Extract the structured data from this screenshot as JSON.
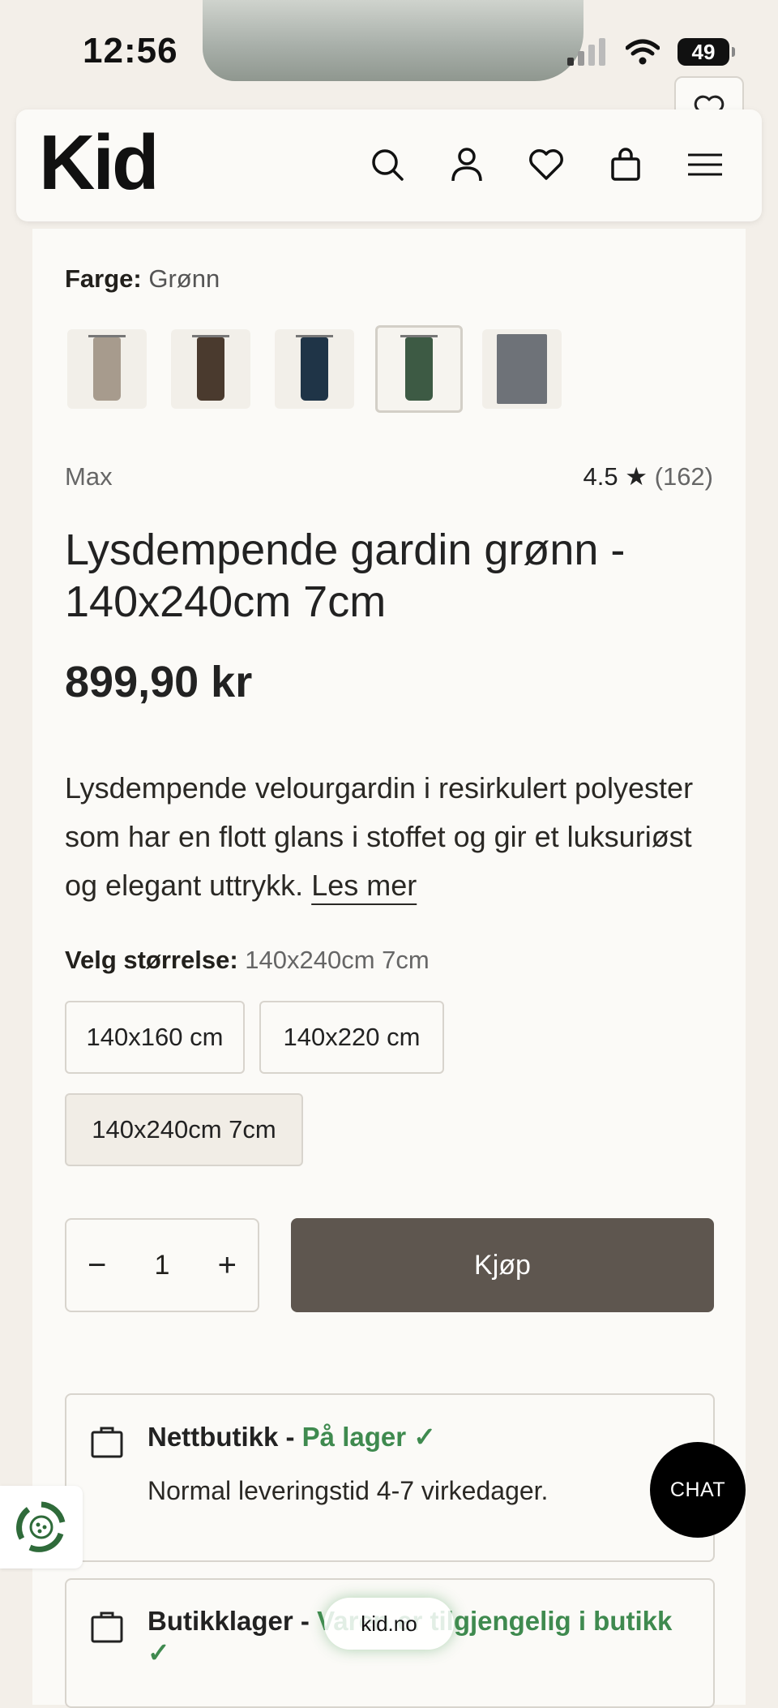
{
  "status_bar": {
    "time": "12:56",
    "battery": "49"
  },
  "header": {
    "logo": "Kid"
  },
  "product": {
    "color_label": "Farge:",
    "color_value": "Grønn",
    "swatches": [
      {
        "name": "beige",
        "color": "#a79b8d"
      },
      {
        "name": "brun",
        "color": "#4a3a2e"
      },
      {
        "name": "blå",
        "color": "#1f3447"
      },
      {
        "name": "grønn",
        "color": "#3d5a44",
        "selected": true
      },
      {
        "name": "grå",
        "color": "#6e7278"
      }
    ],
    "brand": "Max",
    "rating": "4.5 ★",
    "review_count": "(162)",
    "title": "Lysdempende gardin grønn - 140x240cm 7cm",
    "price": "899,90 kr",
    "description": "Lysdempende velourgardin i resirkulert polyester som har en flott glans i stoffet og gir et luksuriøst og elegant uttrykk.",
    "read_more": "Les mer",
    "size_label": "Velg størrelse:",
    "size_value": "140x240cm 7cm",
    "sizes": [
      "140x160 cm",
      "140x220 cm",
      "140x240cm 7cm"
    ],
    "quantity": "1",
    "qty_minus": "−",
    "qty_plus": "+",
    "buy_label": "Kjøp"
  },
  "stock": {
    "online_name": "Nettbutikk -",
    "online_status": "På lager ✓",
    "online_sub": "Normal leveringstid 4-7 virkedager.",
    "store_name": "Butikklager -",
    "store_status": "Varen er tilgjengelig i butikk ✓"
  },
  "chat_label": "CHAT",
  "url": "kid.no",
  "colors": {
    "accent": "#5e564f",
    "green": "#3f8a4f",
    "background": "#f3efe9"
  }
}
